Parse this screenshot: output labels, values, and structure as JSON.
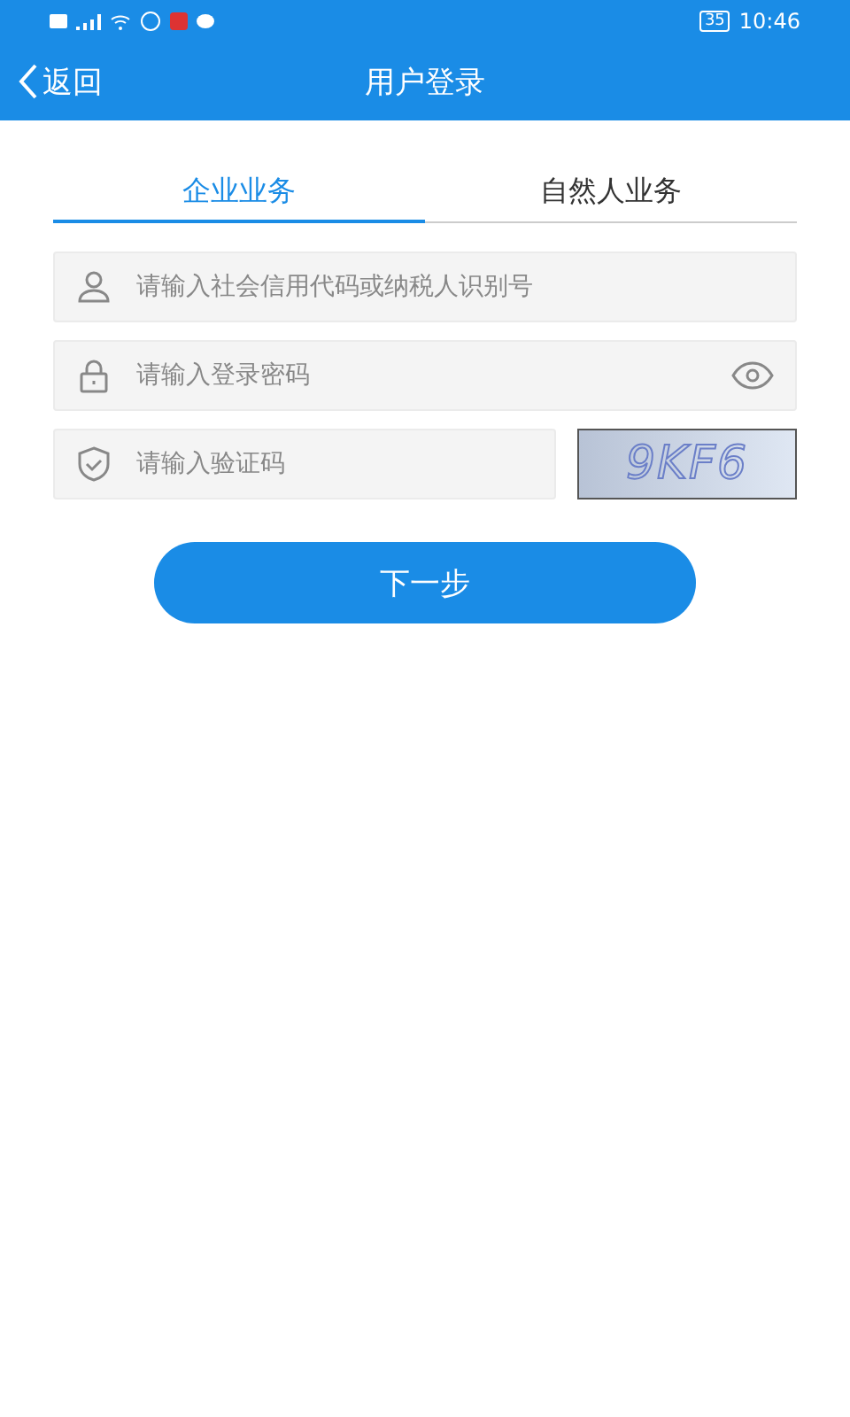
{
  "status_bar": {
    "battery": "35",
    "time": "10:46"
  },
  "header": {
    "back": "返回",
    "title": "用户登录"
  },
  "tabs": [
    {
      "label": "企业业务",
      "selected": true
    },
    {
      "label": "自然人业务",
      "selected": false
    }
  ],
  "fields": [
    {
      "kind": "user",
      "placeholder": "请输入社会信用代码或纳税人识别号"
    },
    {
      "kind": "password",
      "placeholder": "请输入登录密码"
    },
    {
      "kind": "captcha",
      "placeholder": "请输入验证码",
      "captcha": "9KF6"
    }
  ],
  "submit": "下一步"
}
